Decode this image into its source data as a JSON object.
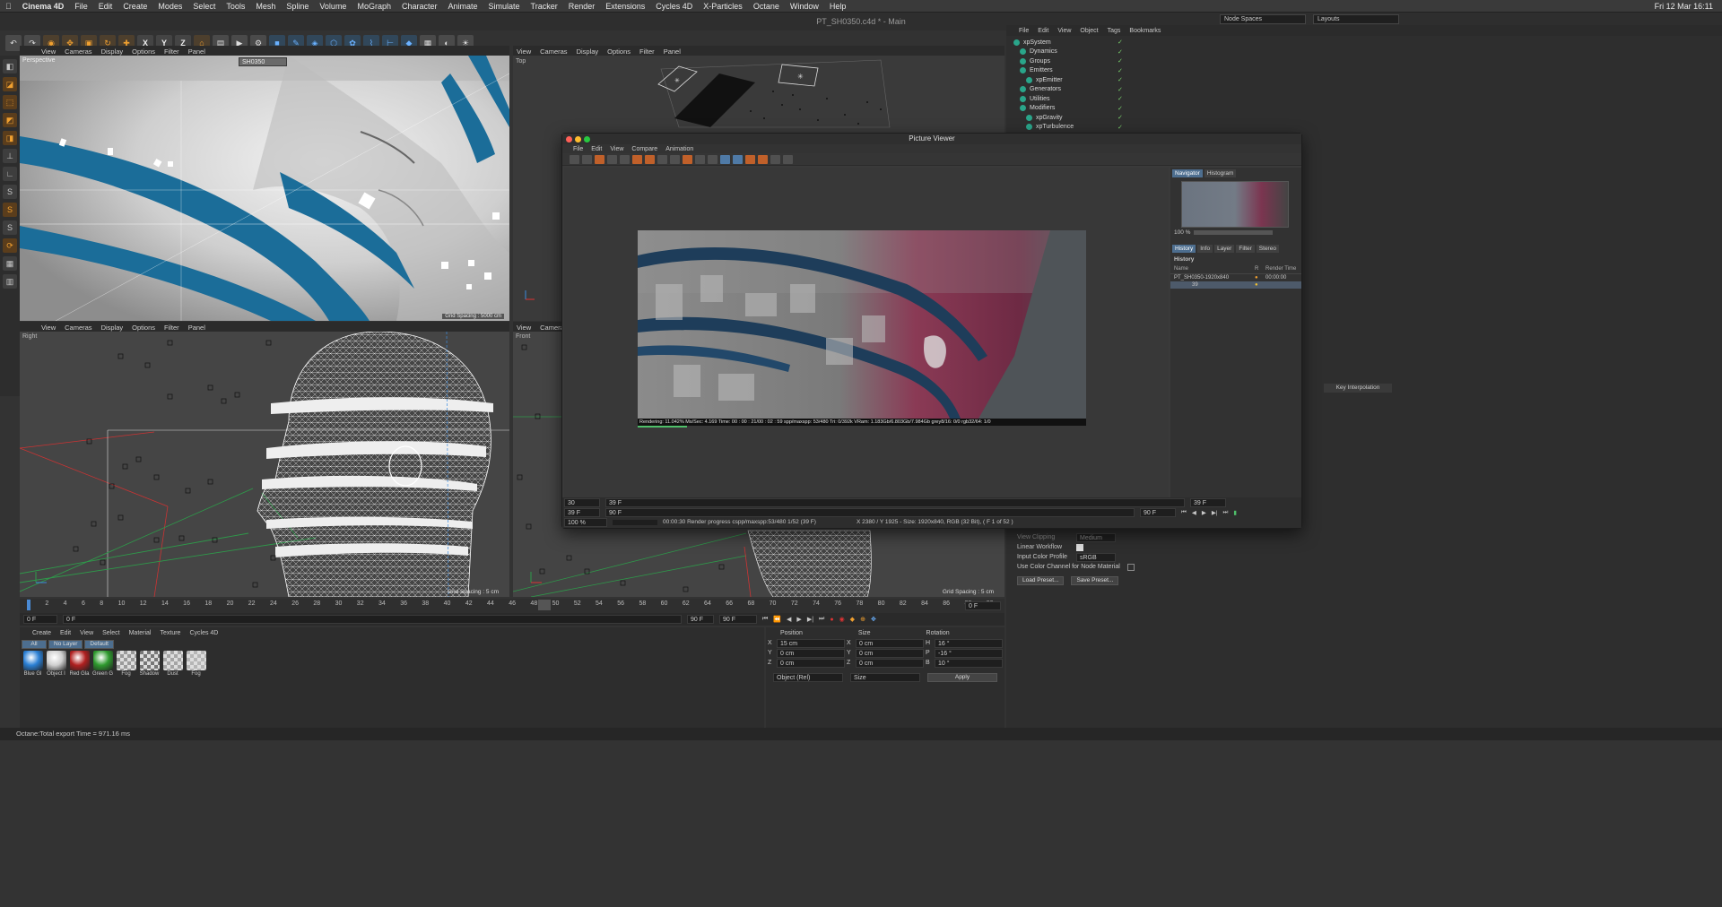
{
  "menubar": {
    "app": "Cinema 4D",
    "items": [
      "File",
      "Edit",
      "Create",
      "Modes",
      "Select",
      "Tools",
      "Mesh",
      "Spline",
      "Volume",
      "MoGraph",
      "Character",
      "Animate",
      "Simulate",
      "Tracker",
      "Render",
      "Extensions",
      "Cycles 4D",
      "X-Particles",
      "Octane",
      "Window",
      "Help"
    ],
    "clock": "Fri 12 Mar  16:11"
  },
  "window_title": "PT_SH0350.c4d * - Main",
  "layout": {
    "node_spaces": "Node Spaces",
    "layouts": "Layouts"
  },
  "viewports": {
    "menu": [
      "View",
      "Cameras",
      "Display",
      "Options",
      "Filter",
      "Panel"
    ],
    "persp_label": "Perspective",
    "persp_camera": "SH0350",
    "persp_grid": "Grid Spacing : 5000 cm",
    "top_label": "Top",
    "right_label": "Right",
    "right_grid": "Grid Spacing : 5 cm",
    "front_label": "Front",
    "front_grid": "Grid Spacing : 5 cm",
    "front_menu": [
      "View",
      "Cameras"
    ]
  },
  "timeline": {
    "ticks": [
      "0",
      "2",
      "4",
      "6",
      "8",
      "10",
      "12",
      "14",
      "16",
      "18",
      "20",
      "22",
      "24",
      "26",
      "28",
      "30",
      "32",
      "34",
      "36",
      "38",
      "40",
      "42",
      "44",
      "46",
      "48",
      "50",
      "52",
      "54",
      "56",
      "58",
      "60",
      "62",
      "64",
      "66",
      "68",
      "70",
      "72",
      "74",
      "76",
      "78",
      "80",
      "82",
      "84",
      "86",
      "88",
      "90"
    ],
    "start": "0 F",
    "current": "0 F",
    "end_a": "90 F",
    "end_b": "90 F",
    "frame_field": "0 F"
  },
  "materials": {
    "menu": [
      "Create",
      "Edit",
      "View",
      "Select",
      "Material",
      "Texture",
      "Cycles 4D"
    ],
    "filters": [
      "All",
      "No Layer",
      "Default"
    ],
    "items": [
      {
        "name": "Blue Gl",
        "color": "#2a7fd4"
      },
      {
        "name": "Object I",
        "color": "#cfcfcf"
      },
      {
        "name": "Red Gla",
        "color": "#b02020"
      },
      {
        "name": "Green G",
        "color": "#2e9a2e"
      },
      {
        "name": "Fog",
        "color": "#9a9a9a"
      },
      {
        "name": "Shadow",
        "color": "#777777"
      },
      {
        "name": "Dust",
        "color": "#a5a5a5"
      },
      {
        "name": "Fog",
        "color": "#b5b5b5"
      }
    ]
  },
  "coords": {
    "headers": [
      "Position",
      "Size",
      "Rotation"
    ],
    "rows": [
      {
        "axis": "X",
        "pos": "15 cm",
        "size_axis": "X",
        "size": "0 cm",
        "rot_axis": "H",
        "rot": "16 °"
      },
      {
        "axis": "Y",
        "pos": "0 cm",
        "size_axis": "Y",
        "size": "0 cm",
        "rot_axis": "P",
        "rot": "-16 °"
      },
      {
        "axis": "Z",
        "pos": "0 cm",
        "size_axis": "Z",
        "size": "0 cm",
        "rot_axis": "B",
        "rot": "10 °"
      }
    ],
    "mode": "Object (Rel)",
    "size_mode": "Size",
    "apply": "Apply"
  },
  "status": "Octane:Total export Time = 971.16 ms",
  "objects": {
    "menu": [
      "File",
      "Edit",
      "View",
      "Object",
      "Tags",
      "Bookmarks"
    ],
    "items": [
      "xpSystem",
      "Dynamics",
      "Groups",
      "Emitters",
      "xpEmitter",
      "Generators",
      "Utilities",
      "Modifiers",
      "xpGravity",
      "xpTurbulence"
    ]
  },
  "attributes": {
    "key_interp": "Key Interpolation",
    "view_clipping": "View Clipping",
    "view_clipping_val": "Medium",
    "linear_workflow": "Linear Workflow",
    "input_color_profile": "Input Color Profile",
    "input_color_val": "sRGB",
    "use_color_channel": "Use Color Channel for Node Material",
    "load_preset": "Load Preset...",
    "save_preset": "Save Preset..."
  },
  "picture_viewer": {
    "title": "Picture Viewer",
    "menu": [
      "File",
      "Edit",
      "View",
      "Compare",
      "Animation"
    ],
    "tabs_top": [
      "Navigator",
      "Histogram"
    ],
    "zoom_nav": "100 %",
    "tabs_side": [
      "History",
      "Info",
      "Layer",
      "Filter",
      "Stereo"
    ],
    "history_title": "History",
    "history_cols": [
      "Name",
      "R",
      "Render Time"
    ],
    "history_rows": [
      {
        "name": "PT_SH0350-1920x840",
        "time": "00:00:00"
      },
      {
        "name": "39",
        "time": ""
      }
    ],
    "render_info": "Rendering: 11.042%  Ms/Sec: 4.169  Time: 00 : 00 : 21/00 : 02 : 59  spp/maxspp: 53/480  Tri: 0/392k  VRam: 1.183Gb/6.803Gb/7.984Gb  grey8/16: 0/0  rgb32/64: 1/0",
    "frame_a": "30",
    "frame_b": "39 F",
    "frame_c": "39 F",
    "frame_end": "90 F",
    "frame_end2": "90 F",
    "frame_right": "39 F",
    "zoom": "100 %",
    "progress": "00:00:30 Render progress  cspp/maxspp:53/480 1/52 (39 F)",
    "size_info": "X 2380 / Y 1925 - Size: 1920x840, RGB (32 Bit),  ( F 1 of 52 )"
  }
}
